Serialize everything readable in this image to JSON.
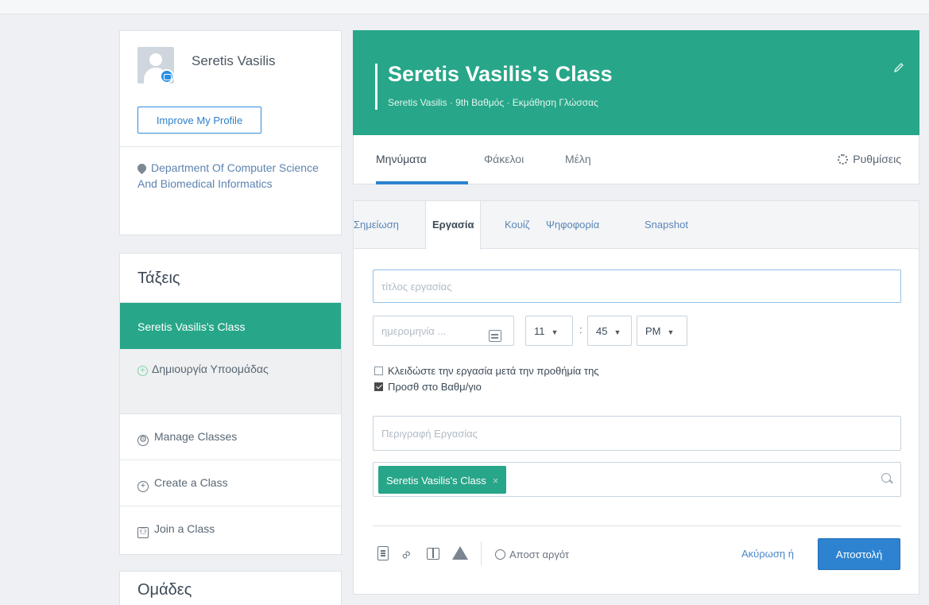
{
  "profile": {
    "name": "Seretis Vasilis",
    "improve_button": "Improve My Profile",
    "school": "Department Of Computer Science And Biomedical Informatics"
  },
  "sidebar": {
    "classes_title": "Τάξεις",
    "active_class": "Seretis Vasilis's Class",
    "create_subgroup": "Δημιουργία Υποομάδας",
    "manage_classes": "Manage Classes",
    "create_class": "Create a Class",
    "join_class": "Join a Class",
    "groups_title": "Ομάδες"
  },
  "header": {
    "title": "Seretis Vasilis's Class",
    "subtitle": "Seretis Vasilis · 9th Βαθμός · Εκμάθηση Γλώσσας"
  },
  "tabs": {
    "messages": "Μηνύματα",
    "folders": "Φάκελοι",
    "members": "Μέλη",
    "settings": "Ρυθμίσεις"
  },
  "post_tabs": {
    "note": "Σημείωση",
    "assignment": "Εργασία",
    "quiz": "Κουίζ",
    "poll": "Ψηφοφορία",
    "snapshot": "Snapshot"
  },
  "form": {
    "title_placeholder": "τίτλος εργασίας",
    "date_placeholder": "ημερομηνία ...",
    "hour": "11",
    "minute": "45",
    "ampm": "PM",
    "colon": ":",
    "lock_label": "Κλειδώστε την εργασία μετά την προθήμία της",
    "lock_checked": false,
    "gradebook_label": "Προσθ στο Βαθμ/γιο",
    "gradebook_checked": true,
    "description_placeholder": "Περιγραφή Εργασίας",
    "recipient_chip": "Seretis Vasilis's Class",
    "chip_remove": "×"
  },
  "footer": {
    "schedule": "Αποστ αργότ",
    "cancel": "Ακύρωση ή",
    "send": "Αποστολή"
  },
  "colors": {
    "brand_green": "#27a689",
    "primary_blue": "#2d83d0"
  }
}
